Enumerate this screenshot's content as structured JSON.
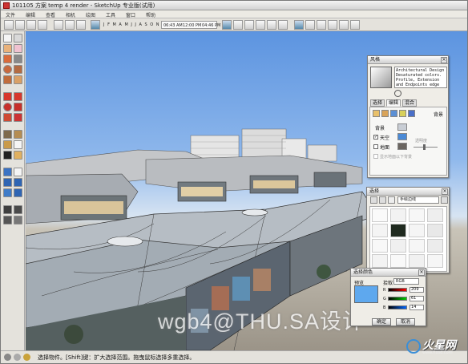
{
  "window": {
    "title": "101105 方案 temp 4 render - SketchUp 专业版(试用)"
  },
  "menu": [
    "文件",
    "编辑",
    "查看",
    "相机",
    "绘图",
    "工具",
    "窗口",
    "帮助"
  ],
  "toolbar": {
    "shadow_months": "J F M A M J J A S O N D",
    "time_start": "06:43 AM",
    "time_noon": "12:00 PM",
    "time_end": "04:46 PM",
    "month_highlight_color": "#4f6fa8"
  },
  "viewport": {
    "watermark": "wgb4@THU.SA设计"
  },
  "styles_panel": {
    "title": "风格",
    "style_name": "Architectural Design",
    "style_description": "Desaturated colors. Profile, Extension and Endpoints edge",
    "tabs": [
      {
        "label": "选择",
        "active": false
      },
      {
        "label": "编辑",
        "active": true
      },
      {
        "label": "混合",
        "active": false
      }
    ],
    "sub_section": "背景",
    "rows": {
      "background": "背景",
      "sky": "天空",
      "ground": "地面",
      "transparency": "透明度",
      "show_ground_from_below": "显示地面以下背景"
    },
    "sky_checked": true,
    "ground_checked": false,
    "colors": {
      "background": "#c8cdd4",
      "sky": "#4a8ad6",
      "ground": "#6a6560"
    }
  },
  "materials_panel": {
    "title": "选择",
    "collection": "手绘边线"
  },
  "color_picker": {
    "title": "选择颜色",
    "preview_label": "预览",
    "model_label": "拾取",
    "model_value": "RGB",
    "preview_color": "#5ea8ee",
    "channels": [
      {
        "letter": "R",
        "value": "209"
      },
      {
        "letter": "G",
        "value": "61"
      },
      {
        "letter": "B",
        "value": "14"
      }
    ],
    "ok_label": "确定",
    "cancel_label": "取消"
  },
  "status": {
    "text": "选择物件。[Shift]键：扩大选择范围。拖曳鼠标选择多重选择。"
  },
  "logo": {
    "text": "火星网",
    "url": "www.hxsd.com"
  }
}
